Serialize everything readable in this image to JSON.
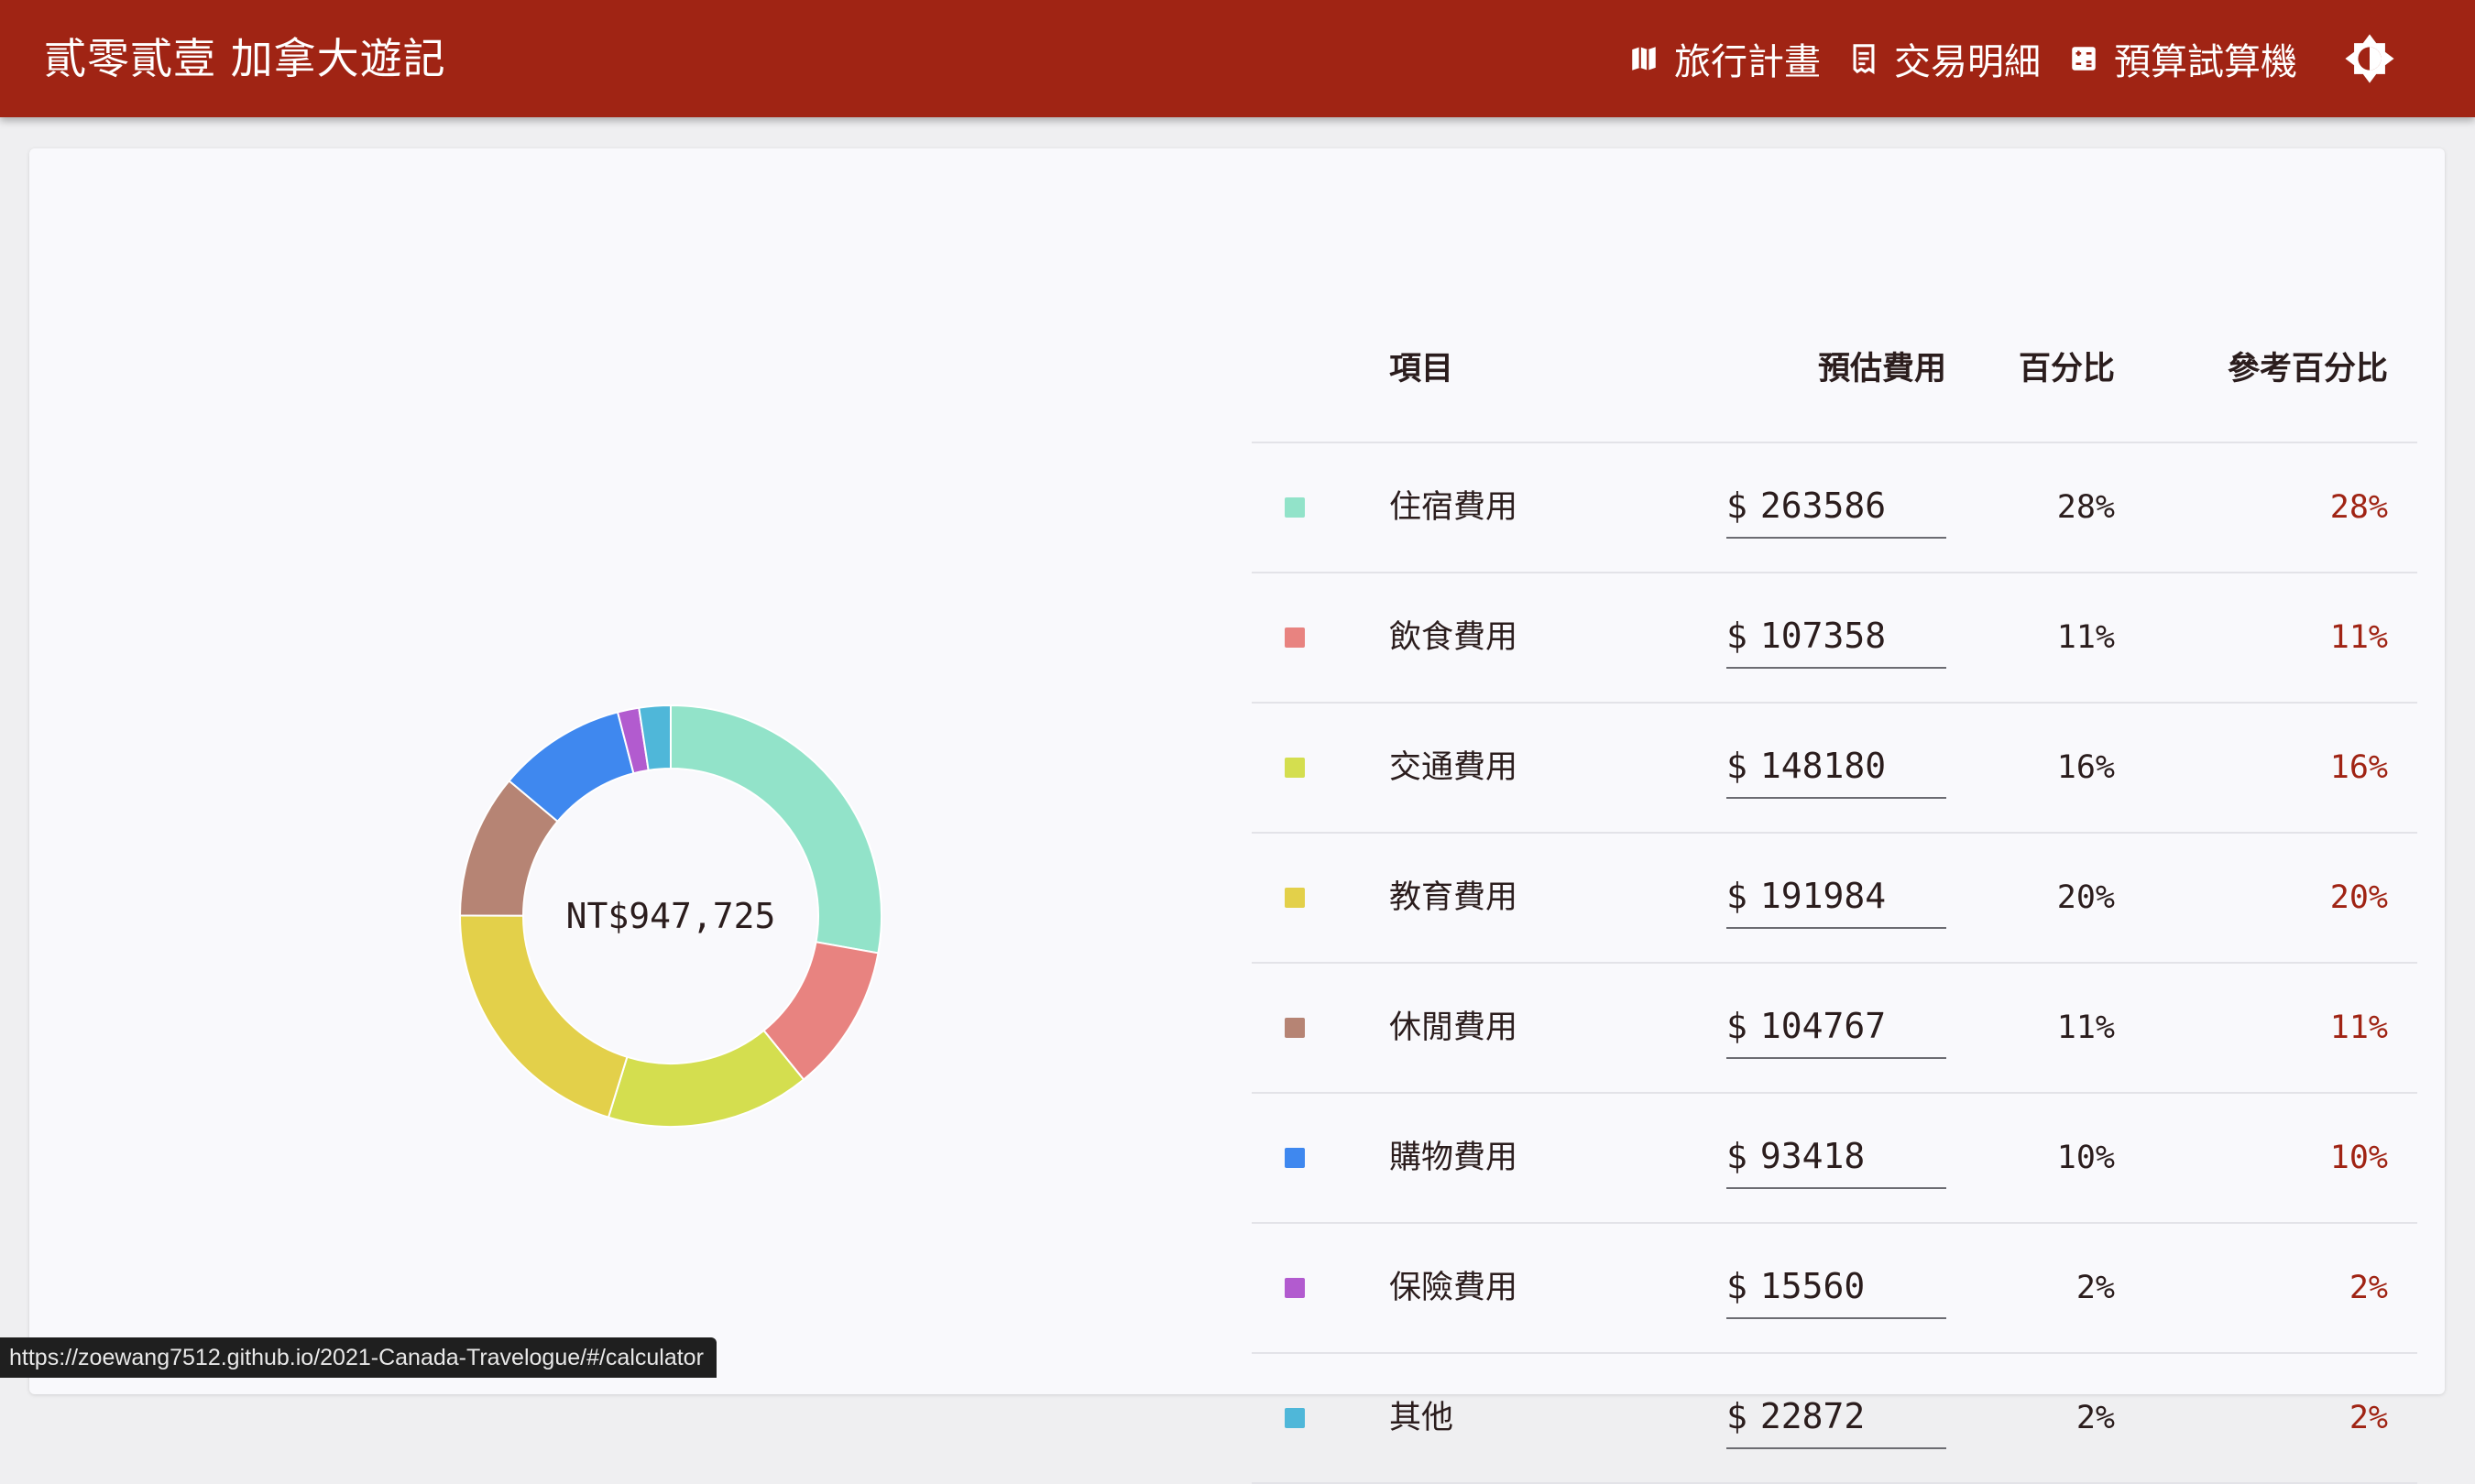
{
  "app": {
    "title": "貳零貳壹 加拿大遊記"
  },
  "nav": [
    {
      "label": "旅行計畫",
      "icon": "map-icon"
    },
    {
      "label": "交易明細",
      "icon": "receipt-icon"
    },
    {
      "label": "預算試算機",
      "icon": "calculator-icon"
    }
  ],
  "theme_toggle": {
    "icon": "brightness-icon"
  },
  "table": {
    "headers": {
      "item": "項目",
      "cost": "預估費用",
      "percent": "百分比",
      "reference": "參考百分比"
    },
    "currency_sign": "$",
    "rows": [
      {
        "name": "住宿費用",
        "cost": "263586",
        "percent": "28%",
        "reference": "28%",
        "color": "#92e3c9"
      },
      {
        "name": "飲食費用",
        "cost": "107358",
        "percent": "11%",
        "reference": "11%",
        "color": "#e88380"
      },
      {
        "name": "交通費用",
        "cost": "148180",
        "percent": "16%",
        "reference": "16%",
        "color": "#d4de4f"
      },
      {
        "name": "教育費用",
        "cost": "191984",
        "percent": "20%",
        "reference": "20%",
        "color": "#e3d04a"
      },
      {
        "name": "休閒費用",
        "cost": "104767",
        "percent": "11%",
        "reference": "11%",
        "color": "#b68474"
      },
      {
        "name": "購物費用",
        "cost": "93418",
        "percent": "10%",
        "reference": "10%",
        "color": "#3f88ef"
      },
      {
        "name": "保險費用",
        "cost": "15560",
        "percent": "2%",
        "reference": "2%",
        "color": "#b25bcf"
      },
      {
        "name": "其他",
        "cost": "22872",
        "percent": "2%",
        "reference": "2%",
        "color": "#4fb7d9"
      }
    ]
  },
  "chart_data": {
    "type": "pie",
    "variant": "donut",
    "center_label": "NT$947,725",
    "categories": [
      "住宿費用",
      "飲食費用",
      "交通費用",
      "教育費用",
      "休閒費用",
      "購物費用",
      "保險費用",
      "其他"
    ],
    "values": [
      263586,
      107358,
      148180,
      191984,
      104767,
      93418,
      15560,
      22872
    ],
    "colors": [
      "#92e3c9",
      "#e88380",
      "#d4de4f",
      "#e3d04a",
      "#b68474",
      "#3f88ef",
      "#b25bcf",
      "#4fb7d9"
    ],
    "legend": "none"
  },
  "status_bar": {
    "url": "https://zoewang7512.github.io/2021-Canada-Travelogue/#/calculator"
  }
}
